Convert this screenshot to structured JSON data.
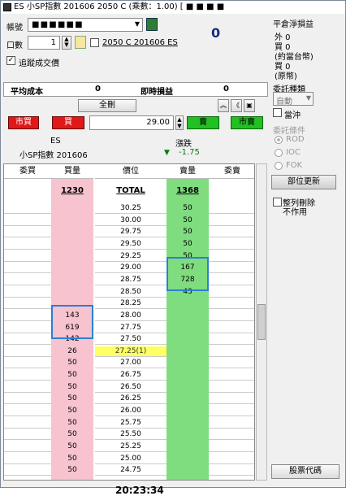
{
  "titlebar": {
    "title": "ES 小SP指數 201606 2050 C (乘數：1.00) [ ■ ■ ■ ■"
  },
  "account": {
    "label": "帳號",
    "value": "■ ■ ■ ■ ■ ■",
    "pnl_value": "0"
  },
  "quantity": {
    "label": "口數",
    "value": "1",
    "product_code": "2050 C 201606 ES"
  },
  "track_fill": {
    "label": "追蹤成交價"
  },
  "summary": {
    "avg_cost_label": "平均成本",
    "avg_cost_value": "0",
    "unrealized_label": "即時損益",
    "unrealized_value": "0"
  },
  "toolbar": {
    "cancel_all": "全刪",
    "market_buy": "市買",
    "buy": "買",
    "sell": "賣",
    "market_sell": "市賣",
    "price": "29.00"
  },
  "quote": {
    "symbol": "ES",
    "name": "小SP指數 201606",
    "change_label": "漲跌",
    "change_value": "-1.75"
  },
  "grid": {
    "headers": [
      "委買",
      "買量",
      "價位",
      "賣量",
      "委賣"
    ],
    "totals": {
      "buy_qty": "1230",
      "price": "TOTAL",
      "sell_qty": "1368"
    },
    "rows": [
      {
        "bid": "",
        "price": "30.25",
        "ask": "50"
      },
      {
        "bid": "",
        "price": "30.00",
        "ask": "50"
      },
      {
        "bid": "",
        "price": "29.75",
        "ask": "50"
      },
      {
        "bid": "",
        "price": "29.50",
        "ask": "50"
      },
      {
        "bid": "",
        "price": "29.25",
        "ask": "50"
      },
      {
        "bid": "",
        "price": "29.00",
        "ask": "167"
      },
      {
        "bid": "",
        "price": "28.75",
        "ask": "728"
      },
      {
        "bid": "",
        "price": "28.50",
        "ask": "43"
      },
      {
        "bid": "",
        "price": "28.25",
        "ask": ""
      },
      {
        "bid": "143",
        "price": "28.00",
        "ask": ""
      },
      {
        "bid": "619",
        "price": "27.75",
        "ask": ""
      },
      {
        "bid": "142",
        "price": "27.50",
        "ask": ""
      },
      {
        "bid": "26",
        "price": "27.25(1)",
        "ask": ""
      },
      {
        "bid": "50",
        "price": "27.00",
        "ask": ""
      },
      {
        "bid": "50",
        "price": "26.75",
        "ask": ""
      },
      {
        "bid": "50",
        "price": "26.50",
        "ask": ""
      },
      {
        "bid": "50",
        "price": "26.25",
        "ask": ""
      },
      {
        "bid": "50",
        "price": "26.00",
        "ask": ""
      },
      {
        "bid": "50",
        "price": "25.75",
        "ask": ""
      },
      {
        "bid": "50",
        "price": "25.50",
        "ask": ""
      },
      {
        "bid": "50",
        "price": "25.25",
        "ask": ""
      },
      {
        "bid": "50",
        "price": "25.00",
        "ask": ""
      },
      {
        "bid": "50",
        "price": "24.75",
        "ask": ""
      }
    ]
  },
  "clock": "20:23:34",
  "right": {
    "settle_title": "平倉淨損益",
    "settle_lines": [
      "外 0",
      "買 0",
      "(約當台幣)",
      "買 0",
      "(原幣)"
    ],
    "order_type_label": "委託種類",
    "order_type_value": "自動",
    "daytrade_label": "當沖",
    "order_cond_label": "委託條件",
    "conds": [
      "ROD",
      "IOC",
      "FOK"
    ],
    "refresh_button": "部位更新",
    "delete_label": "整列刪除",
    "delete_label2": "不作用",
    "stock_code_button": "股票代碼"
  },
  "colors": {
    "buy_col": "#f7c3cf",
    "sell_col": "#7fdc7f",
    "last_price": "#ffff66",
    "highlight": "#2a7fd8"
  }
}
